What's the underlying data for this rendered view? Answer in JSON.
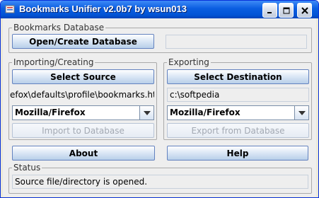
{
  "window": {
    "title": "Bookmarks Unifier v2.0b7 by wsun013",
    "controls": {
      "minimize_icon": "minimize-icon",
      "maximize_icon": "maximize-icon",
      "close_icon": "close-icon"
    }
  },
  "database": {
    "group_title": "Bookmarks Database",
    "open_button": "Open/Create Database",
    "path_value": ""
  },
  "importing": {
    "group_title": "Importing/Creating",
    "select_source_button": "Select Source",
    "source_path": "efox\\defaults\\profile\\bookmarks.html",
    "browser_selected": "Mozilla/Firefox",
    "import_button": "Import to Database",
    "import_enabled": false
  },
  "exporting": {
    "group_title": "Exporting",
    "select_destination_button": "Select Destination",
    "destination_path": "c:\\softpedia",
    "browser_selected": "Mozilla/Firefox",
    "export_button": "Export from Database",
    "export_enabled": false
  },
  "footer": {
    "about_button": "About",
    "help_button": "Help"
  },
  "status": {
    "group_title": "Status",
    "message": "Source file/directory is opened."
  },
  "colors": {
    "titlebar": "#0a5de0",
    "window_bg": "#eeeeee",
    "button_border": "#6382bf",
    "disabled_text": "#a3a9b3"
  }
}
